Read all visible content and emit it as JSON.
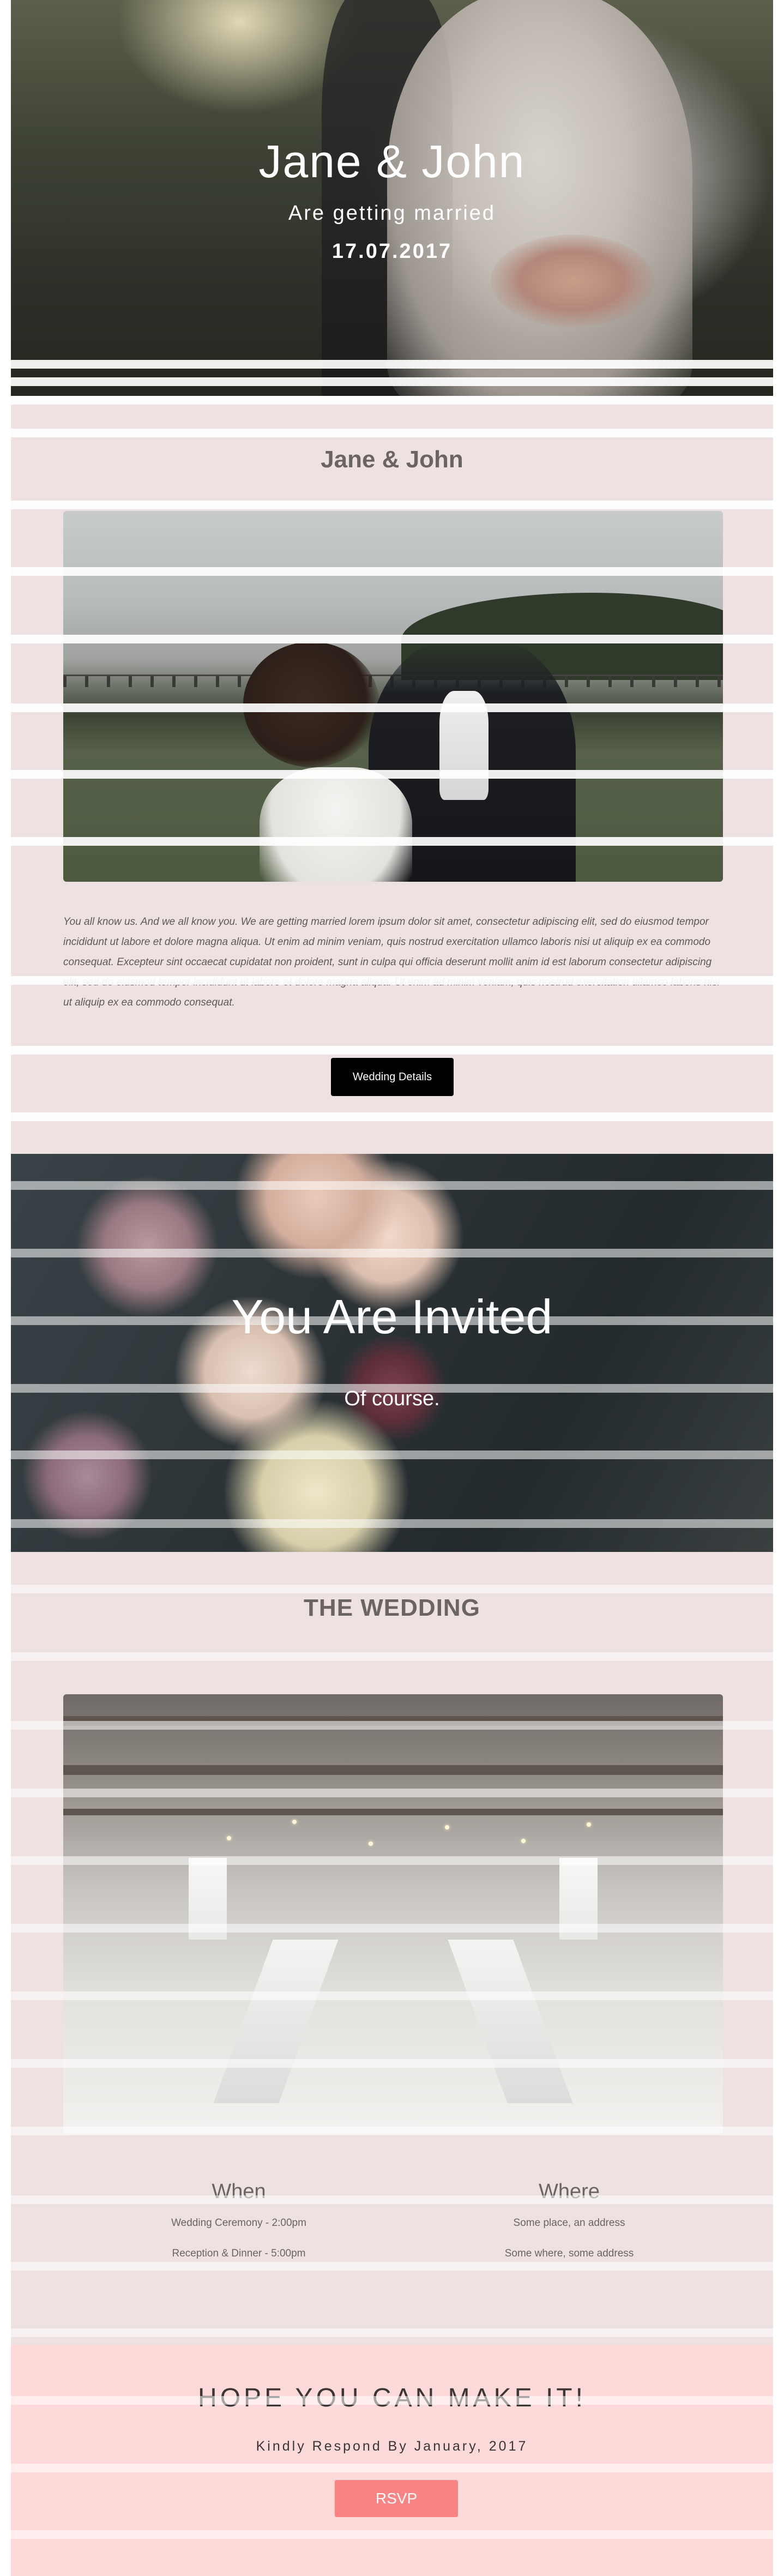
{
  "hero": {
    "title": "Jane & John",
    "subtitle": "Are getting married",
    "date": "17.07.2017"
  },
  "couple_section": {
    "title": "Jane & John",
    "intro": "You all know us. And we all know you. We are getting married lorem ipsum dolor sit amet, consectetur adipiscing elit, sed do eiusmod tempor incididunt ut labore et dolore magna aliqua. Ut enim ad minim veniam, quis nostrud exercitation ullamco laboris nisi ut aliquip ex ea commodo consequat. Excepteur sint occaecat cupidatat non proident, sunt in culpa qui officia deserunt mollit anim id est laborum consectetur adipiscing elit, sed do eiusmod tempor incididunt ut labore et dolore magna aliqua. Ut enim ad minim veniam, quis nostrud exercitation ullamco laboris nisi ut aliquip ex ea commodo consequat.",
    "button_label": "Wedding Details"
  },
  "invited_section": {
    "title": "You Are Invited",
    "subtitle": "Of course."
  },
  "wedding_section": {
    "title": "THE WEDDING",
    "when": {
      "title": "When",
      "lines": [
        "Wedding Ceremony - 2:00pm",
        "Reception & Dinner - 5:00pm"
      ]
    },
    "where": {
      "title": "Where",
      "lines": [
        "Some place, an address",
        "Some where, some address"
      ]
    }
  },
  "rsvp_section": {
    "title": "HOPE YOU CAN MAKE IT!",
    "subtitle": "Kindly Respond By January, 2017",
    "button_label": "RSVP"
  },
  "colors": {
    "page_background": "#ede1e1",
    "rsvp_background": "#fddada",
    "rsvp_button": "#f98483",
    "details_button": "#000000"
  }
}
